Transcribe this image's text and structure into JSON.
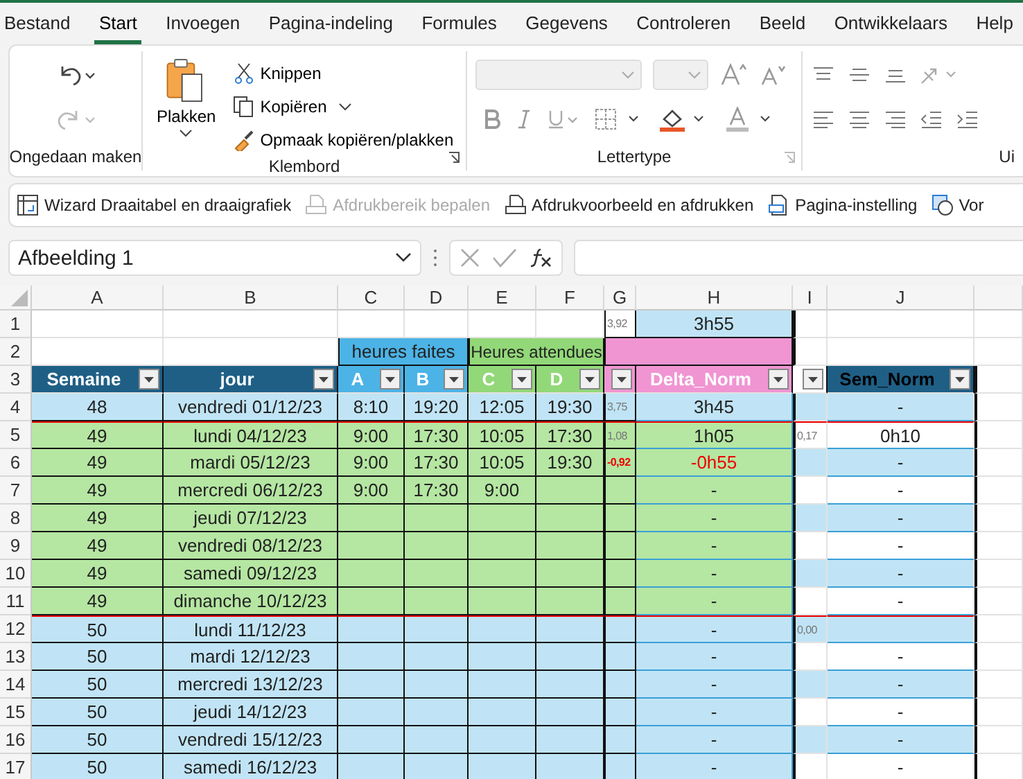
{
  "menu_tabs": [
    {
      "label": "Bestand",
      "selected": false
    },
    {
      "label": "Start",
      "selected": true
    },
    {
      "label": "Invoegen",
      "selected": false
    },
    {
      "label": "Pagina-indeling",
      "selected": false
    },
    {
      "label": "Formules",
      "selected": false
    },
    {
      "label": "Gegevens",
      "selected": false
    },
    {
      "label": "Controleren",
      "selected": false
    },
    {
      "label": "Beeld",
      "selected": false
    },
    {
      "label": "Ontwikkelaars",
      "selected": false
    },
    {
      "label": "Help",
      "selected": false
    }
  ],
  "ribbon": {
    "undo_group": {
      "label": "Ongedaan maken",
      "redo_disabled": true
    },
    "clipboard_group": {
      "label": "Klembord",
      "paste": "Plakken",
      "cut": "Knippen",
      "copy": "Kopiëren",
      "format_painter": "Opmaak kopiëren/plakken"
    },
    "font_group": {
      "label": "Lettertype",
      "disabled": true
    },
    "alignment_group": {
      "label": "Ui"
    }
  },
  "quick_toolbar": [
    {
      "kind": "pivot",
      "label": "Wizard Draaitabel en draaigrafiek",
      "disabled": false
    },
    {
      "kind": "print-area",
      "label": "Afdrukbereik bepalen",
      "disabled": true
    },
    {
      "kind": "print-preview",
      "label": "Afdrukvoorbeeld en afdrukken",
      "disabled": false
    },
    {
      "kind": "page-setup",
      "label": "Pagina-instelling",
      "disabled": false
    },
    {
      "kind": "shape",
      "label": "Vor"
    }
  ],
  "formula_bar": {
    "name_box": "Afbeelding 1"
  },
  "sheet": {
    "column_letters": [
      "A",
      "B",
      "C",
      "D",
      "E",
      "F",
      "G",
      "H",
      "I",
      "J"
    ],
    "summary_row": {
      "number": "1",
      "g": "3,92",
      "h": "3h55"
    },
    "group_row": {
      "number": "2",
      "groups": [
        {
          "label": "heures faites",
          "color": "#4cb3e6"
        },
        {
          "label": "Heures attendues",
          "color": "#92d878"
        }
      ]
    },
    "header_row": {
      "number": "3",
      "columns": [
        {
          "label": "Semaine",
          "color": "#1f5f86"
        },
        {
          "label": "jour",
          "color": "#1f5f86"
        },
        {
          "label": "A",
          "color": "#4cb3e6"
        },
        {
          "label": "B",
          "color": "#4cb3e6"
        },
        {
          "label": "C",
          "color": "#92d878"
        },
        {
          "label": "D",
          "color": "#92d878"
        },
        {
          "color": "#f095d2"
        },
        {
          "label": "Delta_Norm",
          "color": "#f095d2"
        },
        {
          "color": "#ffffff"
        },
        {
          "label": "Sem_Norm",
          "color": "#1f5f86"
        }
      ]
    },
    "rows": [
      {
        "number": "4",
        "week": "48",
        "day": "vendredi 01/12/23",
        "a": "8:10",
        "b": "19:20",
        "c": "12:05",
        "d": "19:30",
        "g": "3,75",
        "h": "3h45",
        "j": "-",
        "color": "#c0e4f5",
        "week_break": false,
        "negative": false
      },
      {
        "number": "5",
        "week": "49",
        "day": "lundi 04/12/23",
        "a": "9:00",
        "b": "17:30",
        "c": "10:05",
        "d": "17:30",
        "g": "1,08",
        "h": "1h05",
        "i": "0,17",
        "j": "0h10",
        "color": "#b5e6a2",
        "week_break": true,
        "negative": false
      },
      {
        "number": "6",
        "week": "49",
        "day": "mardi 05/12/23",
        "a": "9:00",
        "b": "17:30",
        "c": "10:05",
        "d": "19:30",
        "g": "-0,92",
        "h": "-0h55",
        "j": "-",
        "color": "#b5e6a2",
        "week_break": false,
        "negative": true
      },
      {
        "number": "7",
        "week": "49",
        "day": "mercredi 06/12/23",
        "a": "9:00",
        "b": "17:30",
        "c": "9:00",
        "h": "-",
        "j": "-",
        "color": "#b5e6a2",
        "week_break": false,
        "negative": false
      },
      {
        "number": "8",
        "week": "49",
        "day": "jeudi 07/12/23",
        "h": "-",
        "j": "-",
        "color": "#b5e6a2",
        "week_break": false,
        "negative": false
      },
      {
        "number": "9",
        "week": "49",
        "day": "vendredi 08/12/23",
        "h": "-",
        "j": "-",
        "color": "#b5e6a2",
        "week_break": false,
        "negative": false
      },
      {
        "number": "10",
        "week": "49",
        "day": "samedi 09/12/23",
        "h": "-",
        "j": "-",
        "color": "#b5e6a2",
        "week_break": false,
        "negative": false
      },
      {
        "number": "11",
        "week": "49",
        "day": "dimanche 10/12/23",
        "h": "-",
        "j": "-",
        "color": "#b5e6a2",
        "week_break": false,
        "negative": false
      },
      {
        "number": "12",
        "week": "50",
        "day": "lundi 11/12/23",
        "h": "-",
        "i": "0,00",
        "color": "#c0e4f5",
        "week_break": true,
        "negative": false
      },
      {
        "number": "13",
        "week": "50",
        "day": "mardi 12/12/23",
        "h": "-",
        "j": "-",
        "color": "#c0e4f5",
        "week_break": false,
        "negative": false
      },
      {
        "number": "14",
        "week": "50",
        "day": "mercredi 13/12/23",
        "h": "-",
        "j": "-",
        "color": "#c0e4f5",
        "week_break": false,
        "negative": false
      },
      {
        "number": "15",
        "week": "50",
        "day": "jeudi 14/12/23",
        "h": "-",
        "j": "-",
        "color": "#c0e4f5",
        "week_break": false,
        "negative": false
      },
      {
        "number": "16",
        "week": "50",
        "day": "vendredi 15/12/23",
        "h": "-",
        "j": "-",
        "color": "#c0e4f5",
        "week_break": false,
        "negative": false
      },
      {
        "number": "17",
        "week": "50",
        "day": "samedi 16/12/23",
        "h": "-",
        "j": "-",
        "color": "#c0e4f5",
        "week_break": false,
        "negative": false
      }
    ]
  }
}
